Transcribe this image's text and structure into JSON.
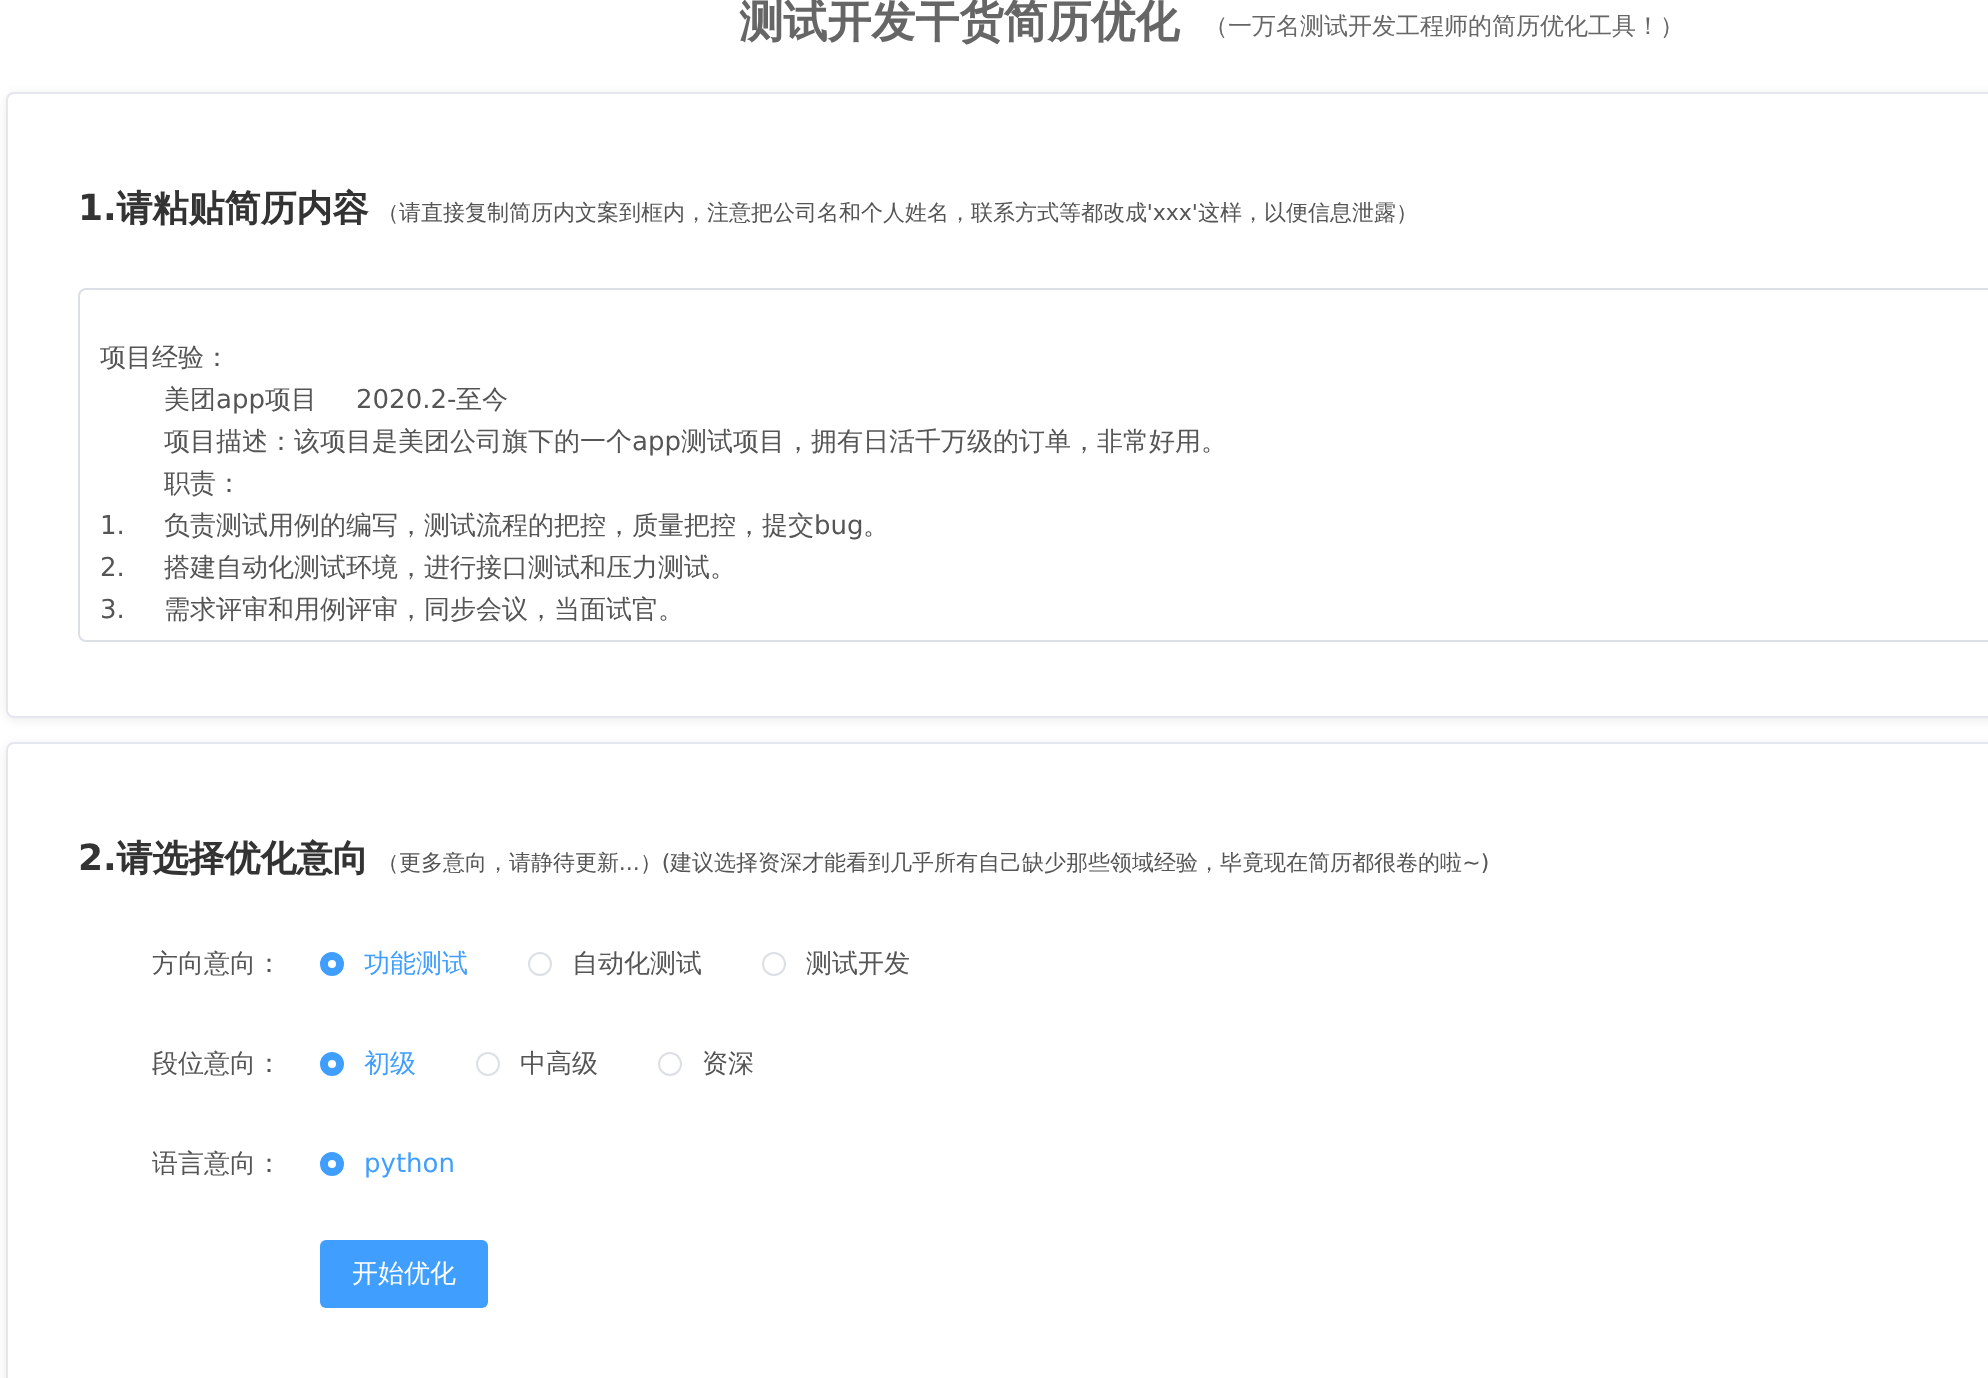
{
  "header": {
    "title": "测试开发干货简历优化",
    "subtitle": "（一万名测试开发工程师的简历优化工具！）"
  },
  "resume_section": {
    "heading": "1.请粘贴简历内容",
    "note": "（请直接复制简历内文案到框内，注意把公司名和个人姓名，联系方式等都改成'xxx'这样，以便信息泄露）",
    "lines": [
      "项目经验：",
      "\t美团app项目\t2020.2-至今",
      "\t项目描述：该项目是美团公司旗下的一个app测试项目，拥有日活千万级的订单，非常好用。",
      "\t职责：",
      "1.\t负责测试用例的编写，测试流程的把控，质量把控，提交bug。",
      "2.\t搭建自动化测试环境，进行接口测试和压力测试。",
      "3.\t需求评审和用例评审，同步会议，当面试官。"
    ]
  },
  "options_section": {
    "heading": "2.请选择优化意向",
    "note": "（更多意向，请静待更新...）(建议选择资深才能看到几乎所有自己缺少那些领域经验，毕竟现在简历都很卷的啦~)",
    "groups": [
      {
        "label": "方向意向：",
        "options": [
          {
            "label": "功能测试",
            "selected": true
          },
          {
            "label": "自动化测试",
            "selected": false
          },
          {
            "label": "测试开发",
            "selected": false
          }
        ]
      },
      {
        "label": "段位意向：",
        "options": [
          {
            "label": "初级",
            "selected": true
          },
          {
            "label": "中高级",
            "selected": false
          },
          {
            "label": "资深",
            "selected": false
          }
        ]
      },
      {
        "label": "语言意向：",
        "options": [
          {
            "label": "python",
            "selected": true
          }
        ]
      }
    ],
    "button": "开始优化"
  }
}
